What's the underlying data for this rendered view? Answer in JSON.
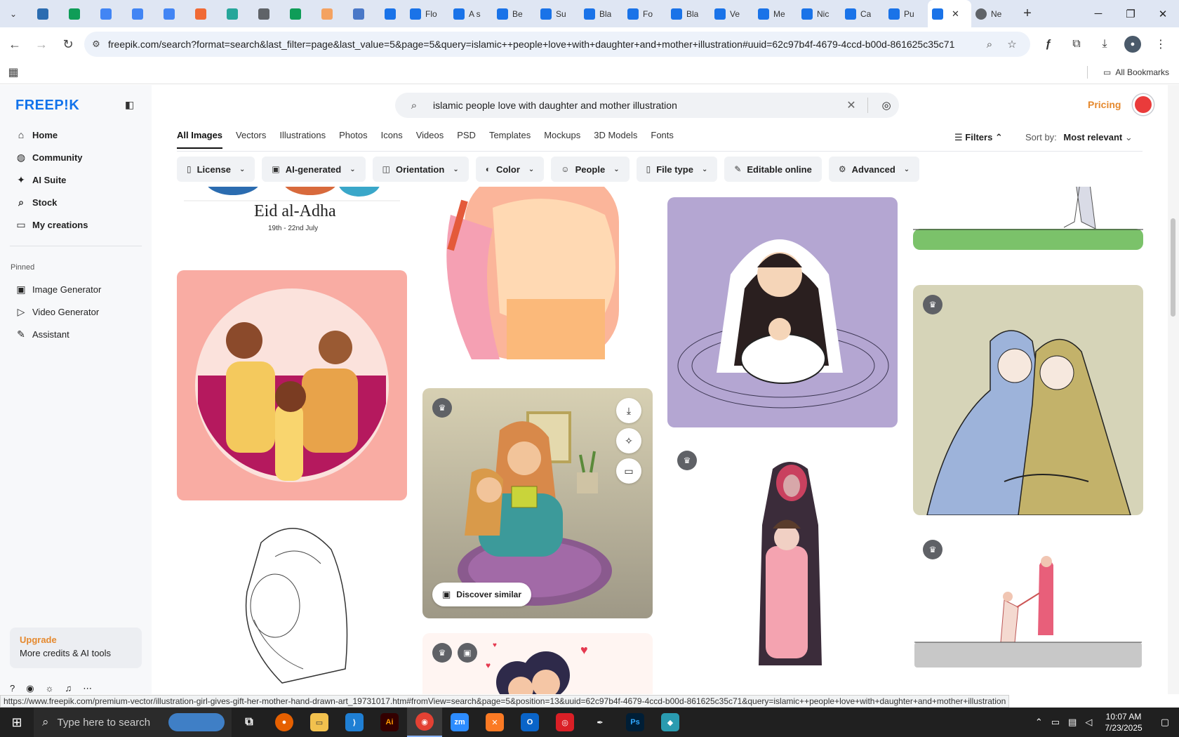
{
  "browser": {
    "tabs": [
      {
        "title": "",
        "color": "#2b6cb0"
      },
      {
        "title": "",
        "color": "#0f9d58"
      },
      {
        "title": "",
        "color": "#4285f4"
      },
      {
        "title": "",
        "color": "#4285f4"
      },
      {
        "title": "",
        "color": "#4285f4"
      },
      {
        "title": "",
        "color": "#f06a35"
      },
      {
        "title": "",
        "color": "#26a69a"
      },
      {
        "title": "",
        "color": "#5f6368"
      },
      {
        "title": "",
        "color": "#0f9d58"
      },
      {
        "title": "",
        "color": "#f4a261"
      },
      {
        "title": "",
        "color": "#4a78c7"
      },
      {
        "title": "",
        "color": "#1a73e8"
      },
      {
        "title": "Flo",
        "color": "#1a73e8"
      },
      {
        "title": "A s",
        "color": "#1a73e8"
      },
      {
        "title": "Be",
        "color": "#1a73e8"
      },
      {
        "title": "Su",
        "color": "#1a73e8"
      },
      {
        "title": "Bla",
        "color": "#1a73e8"
      },
      {
        "title": "Fo",
        "color": "#1a73e8"
      },
      {
        "title": "Bla",
        "color": "#1a73e8"
      },
      {
        "title": "Ve",
        "color": "#1a73e8"
      },
      {
        "title": "Me",
        "color": "#1a73e8"
      },
      {
        "title": "Nic",
        "color": "#1a73e8"
      },
      {
        "title": "Ca",
        "color": "#1a73e8"
      },
      {
        "title": "Pu",
        "color": "#1a73e8"
      }
    ],
    "active_tab_title": "",
    "last_tab_title": "Ne",
    "url": "freepik.com/search?format=search&last_filter=page&last_value=5&page=5&query=islamic++people+love+with+daughter+and+mother+illustration#uuid=62c97b4f-4679-4ccd-b00d-861625c35c71",
    "all_bookmarks": "All Bookmarks",
    "status_url": "https://www.freepik.com/premium-vector/illustration-girl-gives-gift-her-mother-hand-drawn-art_19731017.htm#fromView=search&page=5&position=13&uuid=62c97b4f-4679-4ccd-b00d-861625c35c71&query=islamic++people+love+with+daughter+and+mother+illustration"
  },
  "sidebar": {
    "logo": "FREEP!K",
    "nav": [
      {
        "label": "Home",
        "icon": "home-icon"
      },
      {
        "label": "Community",
        "icon": "globe-icon"
      },
      {
        "label": "AI Suite",
        "icon": "sparkle-icon"
      },
      {
        "label": "Stock",
        "icon": "search-icon"
      },
      {
        "label": "My creations",
        "icon": "folder-icon"
      }
    ],
    "pinned_title": "Pinned",
    "pinned": [
      {
        "label": "Image Generator",
        "icon": "image-icon"
      },
      {
        "label": "Video Generator",
        "icon": "video-icon"
      },
      {
        "label": "Assistant",
        "icon": "assistant-icon"
      }
    ],
    "upgrade_title": "Upgrade",
    "upgrade_subtitle": "More credits & AI tools"
  },
  "header": {
    "search_query": "islamic  people love with daughter and mother illustration",
    "pricing": "Pricing"
  },
  "tabs": [
    "All Images",
    "Vectors",
    "Illustrations",
    "Photos",
    "Icons",
    "Videos",
    "PSD",
    "Templates",
    "Mockups",
    "3D Models",
    "Fonts"
  ],
  "filters_label": "Filters",
  "sort": {
    "label": "Sort by:",
    "value": "Most relevant"
  },
  "filter_chips": [
    "License",
    "AI-generated",
    "Orientation",
    "Color",
    "People",
    "File type",
    "Editable online",
    "Advanced"
  ],
  "results": {
    "eid_title": "Eid al-Adha",
    "eid_date": "19th - 22nd July",
    "discover_similar": "Discover similar"
  },
  "taskbar": {
    "search_placeholder": "Type here to search",
    "time": "10:07 AM",
    "date": "7/23/2025"
  }
}
